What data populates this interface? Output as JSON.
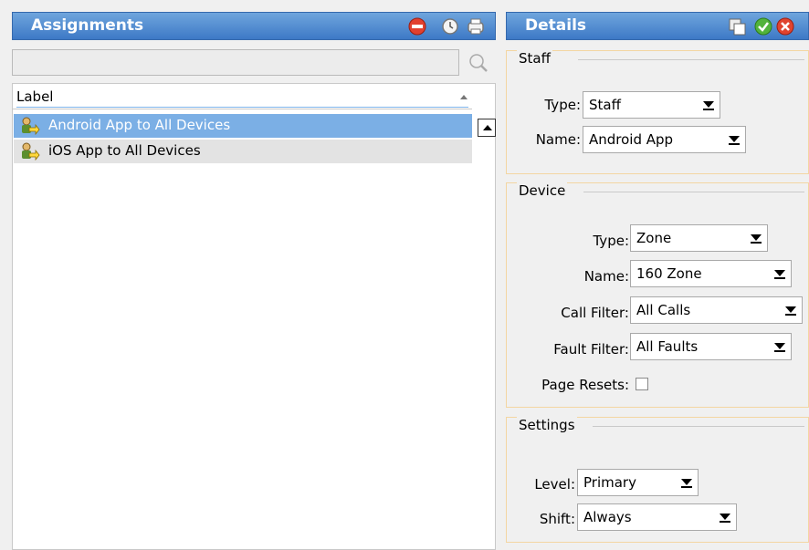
{
  "assignments": {
    "title": "Assignments",
    "toolbar_icons": [
      "remove-assignment-icon",
      "history-icon",
      "print-icon"
    ],
    "search": {
      "value": "",
      "placeholder": ""
    },
    "list": {
      "column_header": "Label",
      "items": [
        {
          "label": "Android App to All Devices",
          "icon": "staff-device-icon",
          "selected": true
        },
        {
          "label": "iOS App to All Devices",
          "icon": "staff-device-icon",
          "selected": false
        }
      ]
    }
  },
  "details": {
    "title": "Details",
    "toolbar_icons": [
      "copy-icon",
      "accept-icon",
      "cancel-icon"
    ],
    "staff": {
      "heading": "Staff",
      "type_label": "Type:",
      "type_value": "Staff",
      "name_label": "Name:",
      "name_value": "Android App"
    },
    "device": {
      "heading": "Device",
      "type_label": "Type:",
      "type_value": "Zone",
      "name_label": "Name:",
      "name_value": "160 Zone",
      "call_filter_label": "Call Filter:",
      "call_filter_value": "All Calls",
      "fault_filter_label": "Fault Filter:",
      "fault_filter_value": "All Faults",
      "page_resets_label": "Page Resets:",
      "page_resets_checked": false
    },
    "settings": {
      "heading": "Settings",
      "level_label": "Level:",
      "level_value": "Primary",
      "shift_label": "Shift:",
      "shift_value": "Always"
    }
  },
  "colors": {
    "titlebar": "#3d79c6",
    "selection": "#7bafe5",
    "group_border": "#f3d6a2"
  }
}
